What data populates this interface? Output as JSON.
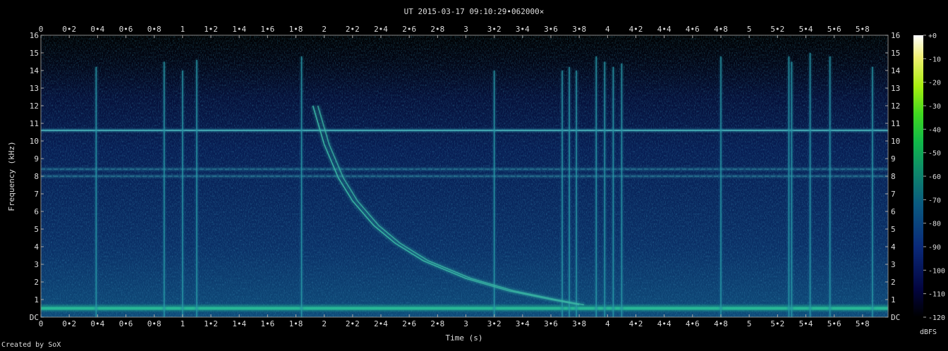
{
  "chart_data": {
    "type": "heatmap",
    "title": "UT 2015-03-17 09:10:29•062000×",
    "xlabel": "Time (s)",
    "ylabel": "Frequency (kHz)",
    "xlim": [
      0,
      5.98
    ],
    "ylim": [
      0,
      16
    ],
    "x_ticks": [
      "0",
      "0•2",
      "0•4",
      "0•6",
      "0•8",
      "1",
      "1•2",
      "1•4",
      "1•6",
      "1•8",
      "2",
      "2•2",
      "2•4",
      "2•6",
      "2•8",
      "3",
      "3•2",
      "3•4",
      "3•6",
      "3•8",
      "4",
      "4•2",
      "4•4",
      "4•6",
      "4•8",
      "5",
      "5•2",
      "5•4",
      "5•6",
      "5•8"
    ],
    "y_ticks": [
      "DC",
      "1",
      "2",
      "3",
      "4",
      "5",
      "6",
      "7",
      "8",
      "9",
      "10",
      "11",
      "12",
      "13",
      "14",
      "15",
      "16"
    ],
    "colorbar": {
      "label": "dBFS",
      "ticks": [
        "+0",
        "-10",
        "-20",
        "-30",
        "-40",
        "-50",
        "-60",
        "-70",
        "-80",
        "-90",
        "-100",
        "-110",
        "-120"
      ],
      "range": [
        -120,
        0
      ]
    },
    "features": {
      "horizontal_lines_khz": [
        10.6,
        8.4,
        8.0
      ],
      "low_band_khz": 0.5,
      "impulses": [
        {
          "t": 0.39,
          "top_khz": 14.2
        },
        {
          "t": 0.87,
          "top_khz": 14.5
        },
        {
          "t": 1.0,
          "top_khz": 14.0
        },
        {
          "t": 1.1,
          "top_khz": 14.6
        },
        {
          "t": 1.84,
          "top_khz": 14.8
        },
        {
          "t": 3.2,
          "top_khz": 14.0
        },
        {
          "t": 3.68,
          "top_khz": 14.0
        },
        {
          "t": 3.73,
          "top_khz": 14.2
        },
        {
          "t": 3.78,
          "top_khz": 14.0
        },
        {
          "t": 3.92,
          "top_khz": 14.8
        },
        {
          "t": 3.98,
          "top_khz": 14.5
        },
        {
          "t": 4.04,
          "top_khz": 14.2
        },
        {
          "t": 4.1,
          "top_khz": 14.4
        },
        {
          "t": 4.8,
          "top_khz": 14.8
        },
        {
          "t": 5.28,
          "top_khz": 14.8
        },
        {
          "t": 5.3,
          "top_khz": 14.5
        },
        {
          "t": 5.43,
          "top_khz": 15.0
        },
        {
          "t": 5.57,
          "top_khz": 14.8
        },
        {
          "t": 5.87,
          "top_khz": 14.2
        }
      ],
      "whistler": [
        {
          "t": 1.92,
          "khz": 12.0
        },
        {
          "t": 2.0,
          "khz": 9.8
        },
        {
          "t": 2.1,
          "khz": 7.9
        },
        {
          "t": 2.2,
          "khz": 6.6
        },
        {
          "t": 2.35,
          "khz": 5.2
        },
        {
          "t": 2.5,
          "khz": 4.2
        },
        {
          "t": 2.7,
          "khz": 3.2
        },
        {
          "t": 3.0,
          "khz": 2.2
        },
        {
          "t": 3.3,
          "khz": 1.5
        },
        {
          "t": 3.6,
          "khz": 1.0
        },
        {
          "t": 3.8,
          "khz": 0.7
        }
      ]
    }
  },
  "footer": {
    "credit": "Created by SoX"
  }
}
